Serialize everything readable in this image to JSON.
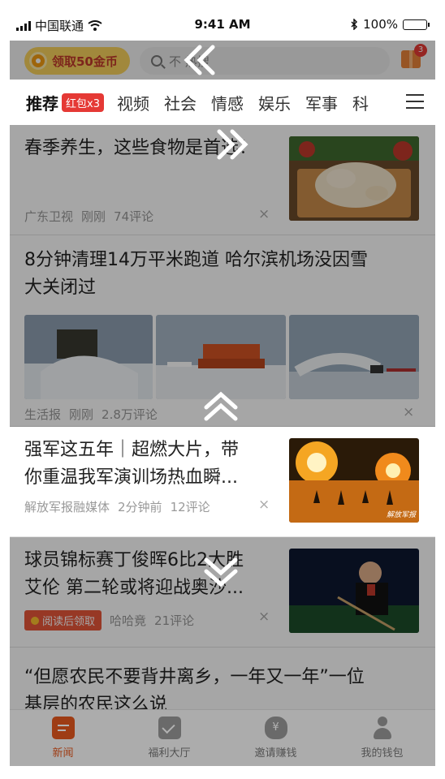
{
  "status_bar": {
    "carrier": "中国联通",
    "time": "9:41 AM",
    "battery": "100%"
  },
  "header": {
    "coin_button": "领取50金币",
    "search_placeholder": "不 热搜",
    "gift_badge": "3"
  },
  "tabs": [
    {
      "label": "推荐",
      "badge": "红包x3"
    },
    {
      "label": "视频"
    },
    {
      "label": "社会"
    },
    {
      "label": "情感"
    },
    {
      "label": "娱乐"
    },
    {
      "label": "军事"
    },
    {
      "label": "科"
    }
  ],
  "feed": [
    {
      "title": "春季养生，这些食物是首选！",
      "source": "广东卫视",
      "time": "刚刚",
      "comments": "74评论"
    },
    {
      "title_line1": "8分钟清理14万平米跑道 哈尔滨机场没因雪",
      "title_line2": "大关闭过",
      "source": "生活报",
      "time": "刚刚",
      "comments": "2.8万评论"
    },
    {
      "title_line1": "强军这五年｜超燃大片，带",
      "title_line2": "你重温我军演训场热血瞬...",
      "source": "解放军报融媒体",
      "time": "2分钟前",
      "comments": "12评论",
      "watermark": "解放军报"
    },
    {
      "title_line1": "球员锦标赛丁俊晖6比2大胜",
      "title_line2": "艾伦 第二轮或将迎战奥沙...",
      "reward_tag": "阅读后领取",
      "source": "哈哈竟",
      "comments": "21评论"
    },
    {
      "title_line1": "“但愿农民不要背井离乡，一年又一年”一位",
      "title_line2": "基层的农民这么说"
    }
  ],
  "close_glyph": "×",
  "bottom_nav": [
    {
      "label": "新闻",
      "icon": "news-icon",
      "active": true
    },
    {
      "label": "福利大厅",
      "icon": "checkbox-icon"
    },
    {
      "label": "邀请赚钱",
      "icon": "money-bag-icon"
    },
    {
      "label": "我的钱包",
      "icon": "person-icon"
    }
  ],
  "colors": {
    "accent": "#e2571e",
    "badge_red": "#e53935",
    "coin_yellow": "#f7d25c"
  }
}
